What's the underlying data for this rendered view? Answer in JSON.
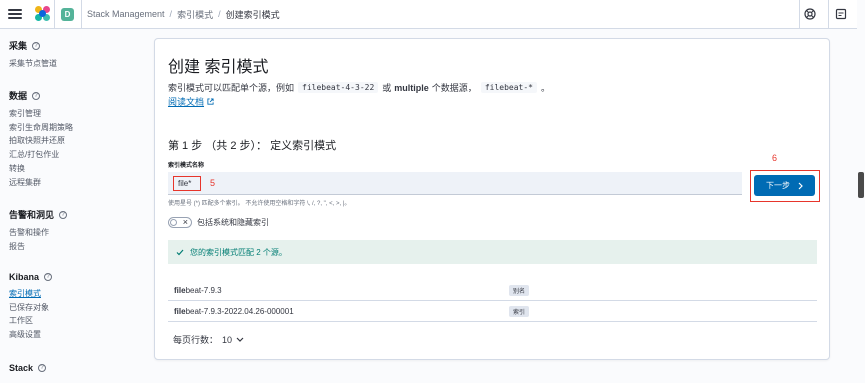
{
  "header": {
    "space_initial": "D",
    "breadcrumbs": [
      "Stack Management",
      "索引模式",
      "创建索引模式"
    ]
  },
  "sidebar": {
    "groups": [
      {
        "title": "采集",
        "items": [
          "采集节点管道"
        ]
      },
      {
        "title": "数据",
        "items": [
          "索引管理",
          "索引生命周期策略",
          "拍取快照并还原",
          "汇总/打包作业",
          "转换",
          "远程集群"
        ]
      },
      {
        "title": "告警和洞见",
        "items": [
          "告警和操作",
          "报告"
        ]
      },
      {
        "title": "Kibana",
        "items": [
          "索引模式",
          "已保存对象",
          "工作区",
          "高级设置"
        ]
      },
      {
        "title": "Stack",
        "items": []
      }
    ],
    "active_item": "索引模式"
  },
  "main": {
    "title": "创建 索引模式",
    "desc_part1": "索引模式可以匹配单个源，例如",
    "desc_code1": "filebeat-4-3-22",
    "desc_part2": "或",
    "desc_bold": "multiple",
    "desc_part3": "个数据源，",
    "desc_code2": "filebeat-*",
    "desc_part4": "。",
    "doc_link": "阅读文档",
    "step_title": "第 1 步 （共 2 步）： 定义索引模式",
    "field_label": "索引模式名称",
    "field_value": "file*",
    "annotation_5": "5",
    "annotation_6": "6",
    "helper": "使用星号 (*) 匹配多个索引。 不允许使用空格和字符 \\, /, ?, \", <, >, |。",
    "toggle_label": "包括系统和隐藏索引",
    "next_button": "下一步",
    "callout": "您的索引模式匹配 2 个源。",
    "rows": [
      {
        "match": "file",
        "rest": "beat-7.9.3",
        "type": "别名"
      },
      {
        "match": "file",
        "rest": "beat-7.9.3-2022.04.26-000001",
        "type": "索引"
      }
    ],
    "per_page_label": "每页行数：",
    "per_page_value": "10"
  },
  "colors": {
    "primary": "#006bb4",
    "annotation": "#e7352b",
    "success": "#017d73"
  }
}
